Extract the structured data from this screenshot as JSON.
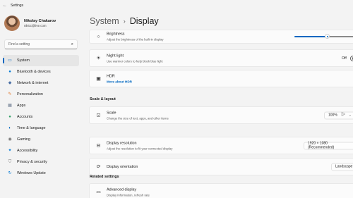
{
  "window": {
    "title": "Settings",
    "back_glyph": "←"
  },
  "profile": {
    "name": "Nikolay Chakarov",
    "email": "nikicc@live.com"
  },
  "search": {
    "placeholder": "Find a setting",
    "icon": "search-icon"
  },
  "nav": [
    {
      "label": "System",
      "icon": "monitor-icon",
      "glyph": "▭",
      "color": "#0067c0",
      "active": true
    },
    {
      "label": "Bluetooth & devices",
      "icon": "bluetooth-icon",
      "glyph": "●",
      "color": "#0078d4"
    },
    {
      "label": "Network & internet",
      "icon": "network-icon",
      "glyph": "◆",
      "color": "#4a6fa5"
    },
    {
      "label": "Personalization",
      "icon": "brush-icon",
      "glyph": "✎",
      "color": "#e07020"
    },
    {
      "label": "Apps",
      "icon": "apps-icon",
      "glyph": "▦",
      "color": "#6b7a8f"
    },
    {
      "label": "Accounts",
      "icon": "person-icon",
      "glyph": "●",
      "color": "#2f9e63"
    },
    {
      "label": "Time & language",
      "icon": "globe-clock-icon",
      "glyph": "◐",
      "color": "#0067c0"
    },
    {
      "label": "Gaming",
      "icon": "gamepad-icon",
      "glyph": "◉",
      "color": "#707070"
    },
    {
      "label": "Accessibility",
      "icon": "accessibility-icon",
      "glyph": "✦",
      "color": "#0078d4"
    },
    {
      "label": "Privacy & security",
      "icon": "shield-icon",
      "glyph": "⛉",
      "color": "#6f6f6f"
    },
    {
      "label": "Windows Update",
      "icon": "update-icon",
      "glyph": "↻",
      "color": "#0078d4"
    }
  ],
  "breadcrumb": {
    "parent": "System",
    "separator": "›",
    "current": "Display"
  },
  "brightness": {
    "title": "Brightness",
    "subtitle": "Adjust the brightness of the built-in display",
    "icon": "sun-icon",
    "value_fraction": 0.51
  },
  "night_light": {
    "title": "Night light",
    "subtitle": "Use warmer colors to help block blue light",
    "icon": "night-light-icon",
    "toggle_label": "Off"
  },
  "hdr": {
    "title": "HDR",
    "link": "More about HDR",
    "icon": "hdr-icon"
  },
  "scale_layout": {
    "heading": "Scale & layout"
  },
  "scale": {
    "title": "Scale",
    "subtitle": "Change the size of text, apps, and other items",
    "icon": "scale-icon",
    "value": "100%"
  },
  "resolution": {
    "title": "Display resolution",
    "subtitle": "Adjust the resolution to fit your connected display",
    "icon": "resolution-icon",
    "value": "1920 × 1080 (Recommended)"
  },
  "orientation": {
    "title": "Display orientation",
    "icon": "orientation-icon",
    "value": "Landscape"
  },
  "related": {
    "heading": "Related settings"
  },
  "advanced": {
    "title": "Advanced display",
    "subtitle": "Display information, refresh rate",
    "icon": "advanced-display-icon"
  },
  "colors": {
    "accent": "#0067c0",
    "background": "#f3f3f3",
    "card": "#fbfbfb"
  }
}
